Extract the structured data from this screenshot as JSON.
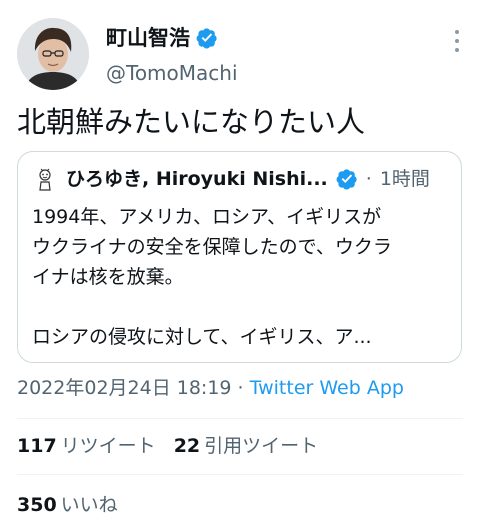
{
  "author": {
    "name": "町山智浩",
    "handle": "@TomoMachi"
  },
  "tweet": {
    "text": "北朝鮮みたいになりたい人",
    "timestamp": "2022年02月24日 18:19",
    "separator": " · ",
    "source": "Twitter Web App"
  },
  "quoted": {
    "author_name": "ひろゆき, Hiroyuki Nishi...",
    "separator": "·",
    "time": "1時間",
    "lines": [
      "1994年、アメリカ、ロシア、イギリスが",
      "ウクライナの安全を保障したので、ウクラ",
      "イナは核を放棄。",
      "",
      "ロシアの侵攻に対して、イギリス、ア..."
    ]
  },
  "stats": {
    "retweets": {
      "count": "117",
      "label": "リツイート"
    },
    "quotes": {
      "count": "22",
      "label": "引用ツイート"
    },
    "likes": {
      "count": "350",
      "label": "いいね"
    }
  },
  "colors": {
    "accent": "#1d9bf0",
    "secondary_text": "#536471",
    "border": "#cfd9de"
  }
}
